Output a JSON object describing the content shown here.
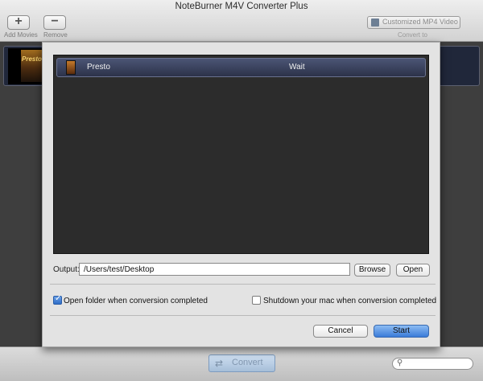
{
  "window": {
    "title": "NoteBurner M4V Converter Plus"
  },
  "toolbar": {
    "add_label": "Add Movies",
    "remove_label": "Remove",
    "convert_to_value": "Customized MP4 Video",
    "convert_to_label": "Convert to"
  },
  "list": {
    "poster_text": "Presto"
  },
  "sheet": {
    "queue": [
      {
        "title": "Presto",
        "status": "Wait"
      }
    ],
    "output_label": "Output:",
    "output_path": "/Users/test/Desktop",
    "browse_label": "Browse",
    "open_label": "Open",
    "open_folder_label": "Open folder when conversion completed",
    "open_folder_checked": true,
    "shutdown_label": "Shutdown your mac when conversion completed",
    "shutdown_checked": false,
    "cancel_label": "Cancel",
    "start_label": "Start"
  },
  "bottom": {
    "convert_label": "Convert",
    "search_value": ""
  }
}
